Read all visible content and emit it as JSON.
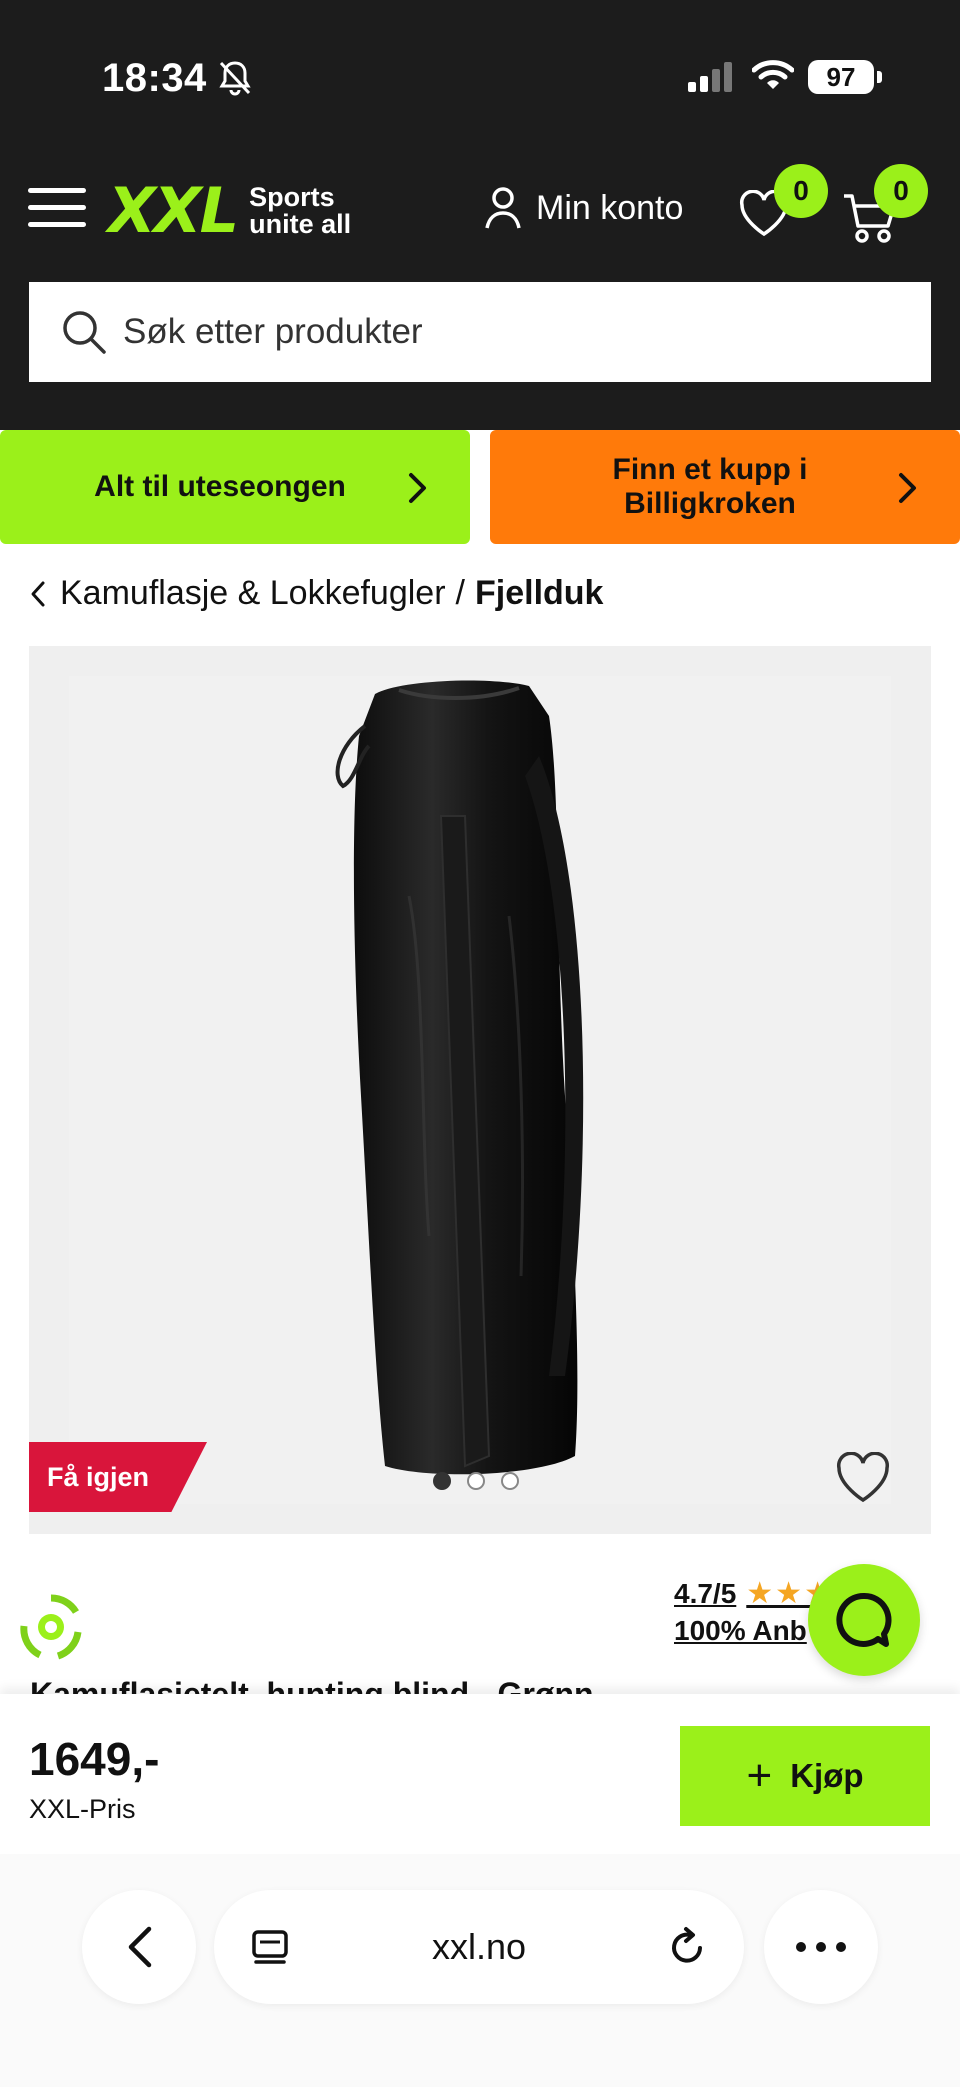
{
  "status_bar": {
    "time": "18:34",
    "battery": "97"
  },
  "header": {
    "logo": "XXL",
    "logo_tagline_1": "Sports",
    "logo_tagline_2": "unite all",
    "account_label": "Min konto",
    "wishlist_count": "0",
    "cart_count": "0"
  },
  "search": {
    "placeholder": "Søk etter produkter"
  },
  "promos": [
    {
      "label": "Alt til uteseongen",
      "color": "#9bf01a"
    },
    {
      "label_line1": "Finn et kupp i",
      "label_line2": "Billigkroken",
      "color": "#ff7a0a"
    }
  ],
  "breadcrumb": {
    "parent": "Kamuflasje & Lokkefugler",
    "separator": "/",
    "current": "Fjellduk"
  },
  "product": {
    "badge": "Få igjen",
    "image_count": 3,
    "active_image": 1,
    "rating": "4.7/5",
    "rating_value": 4.7,
    "recommend": "100% Anb",
    "title_partial": "Kamuflasjetelt, hunting blind - Grønn",
    "price": "1649,-",
    "price_label": "XXL-Pris",
    "buy_label": "Kjøp"
  },
  "browser": {
    "url": "xxl.no"
  },
  "colors": {
    "brand_green": "#9bf01a",
    "header_dark": "#1c1c1c",
    "badge_red": "#d9153b",
    "star": "#f5a623"
  }
}
